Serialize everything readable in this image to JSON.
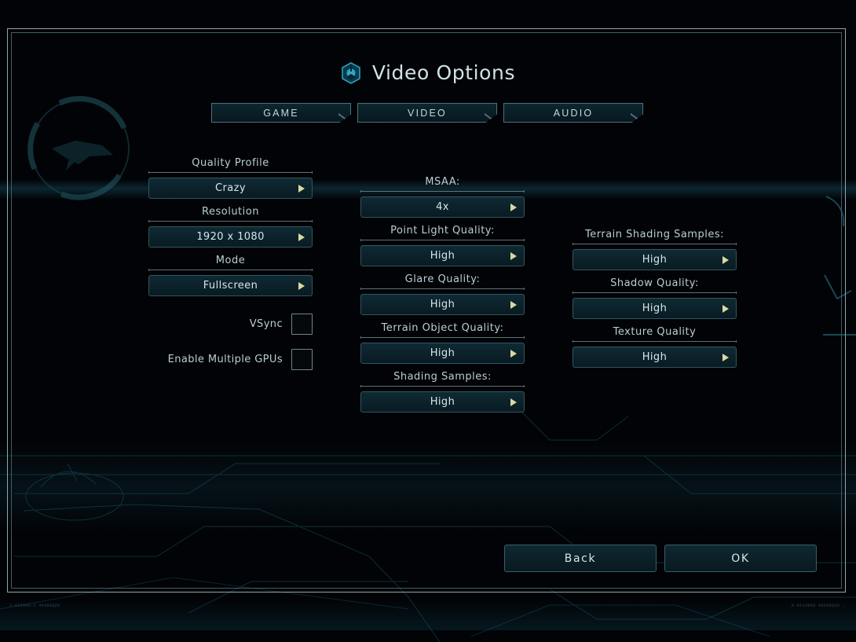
{
  "header": {
    "title": "Video Options",
    "icon": "shield-hex-icon"
  },
  "tabs": [
    {
      "label": "GAME",
      "active": false
    },
    {
      "label": "VIDEO",
      "active": true
    },
    {
      "label": "AUDIO",
      "active": false
    }
  ],
  "columns": {
    "left": {
      "fields": [
        {
          "label": "Quality Profile",
          "value": "Crazy"
        },
        {
          "label": "Resolution",
          "value": "1920 x 1080"
        },
        {
          "label": "Mode",
          "value": "Fullscreen"
        }
      ],
      "checkboxes": [
        {
          "label": "VSync",
          "checked": false
        },
        {
          "label": "Enable Multiple GPUs",
          "checked": false
        }
      ]
    },
    "middle": {
      "fields": [
        {
          "label": "MSAA:",
          "value": "4x"
        },
        {
          "label": "Point Light Quality:",
          "value": "High"
        },
        {
          "label": "Glare Quality:",
          "value": "High"
        },
        {
          "label": "Terrain Object Quality:",
          "value": "High"
        },
        {
          "label": "Shading Samples:",
          "value": "High"
        }
      ]
    },
    "right": {
      "fields": [
        {
          "label": "Terrain Shading Samples:",
          "value": "High"
        },
        {
          "label": "Shadow Quality:",
          "value": "High"
        },
        {
          "label": "Texture Quality",
          "value": "High"
        }
      ]
    }
  },
  "footer": {
    "back_label": "Back",
    "ok_label": "OK"
  },
  "decor": {
    "micro_left": "X-022000-Z 46680QZN",
    "micro_right": "K-0113090 46680QZH :"
  },
  "colors": {
    "background": "#010306",
    "frame_outer": "#8fa7ad",
    "frame_inner": "#415c66",
    "text_primary": "#d6e6ec",
    "text_label": "#b9ced6",
    "accent_arrow": "#d9d9a0",
    "control_border": "#2f5662",
    "control_fill": "#0c222b",
    "wireframe": "#1b5a68"
  }
}
